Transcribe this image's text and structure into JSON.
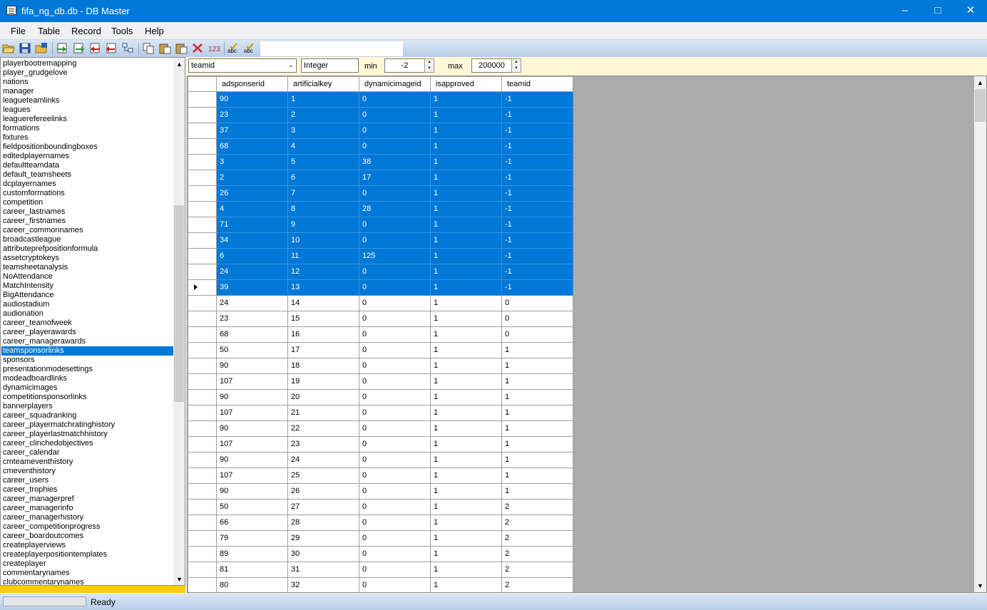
{
  "window": {
    "title": "fifa_ng_db.db - DB Master"
  },
  "menu": [
    "File",
    "Table",
    "Record",
    "Tools",
    "Help"
  ],
  "toolbar_icons": [
    "open-icon",
    "save-icon",
    "save-as-icon",
    "import-icon",
    "export-icon",
    "export-all-icon",
    "import-all-icon",
    "structure-icon",
    "copy-icon",
    "paste-icon",
    "paste-special-icon",
    "delete-icon",
    "numeric-icon",
    "spell-check-icon",
    "spell-check-all-icon"
  ],
  "sidebar": {
    "selected_index": 31,
    "items": [
      "playerbootremapping",
      "player_grudgelove",
      "nations",
      "manager",
      "leagueteamlinks",
      "leagues",
      "leaguerefereelinks",
      "formations",
      "fixtures",
      "fieldpositionboundingboxes",
      "editedplayernames",
      "defaultteamdata",
      "default_teamsheets",
      "dcplayernames",
      "customformations",
      "competition",
      "career_lastnames",
      "career_firstnames",
      "career_commonnames",
      "broadcastleague",
      "attributeprefpositionformula",
      "assetcryptokeys",
      "teamsheetanalysis",
      "NoAttendance",
      "MatchIntensity",
      "BigAttendance",
      "audiostadium",
      "audionation",
      "career_teamofweek",
      "career_playerawards",
      "career_managerawards",
      "teamsponsorlinks",
      "sponsors",
      "presentationmodesettings",
      "modeadboardlinks",
      "dynamicimages",
      "competitionsponsorlinks",
      "bannerplayers",
      "career_squadranking",
      "career_playermatchratinghistory",
      "career_playerlastmatchhistory",
      "career_clinchedobjectives",
      "career_calendar",
      "cmteameventhistory",
      "cmeventhistory",
      "career_users",
      "career_trophies",
      "career_managerpref",
      "career_managerinfo",
      "career_managerhistory",
      "career_competitionprogress",
      "career_boardoutcomes",
      "createplayerviews",
      "createplayerpositiontemplates",
      "createplayer",
      "commentarynames",
      "clubcommentarynames"
    ]
  },
  "filter": {
    "field": "teamid",
    "type": "Integer",
    "min_label": "min",
    "min_value": "-2",
    "max_label": "max",
    "max_value": "200000"
  },
  "grid": {
    "columns": [
      "adsponserid",
      "artificialkey",
      "dynamicimageid",
      "isapproved",
      "teamid"
    ],
    "selected_count": 13,
    "current_row": 12,
    "rows": [
      [
        "90",
        "1",
        "0",
        "1",
        "-1"
      ],
      [
        "23",
        "2",
        "0",
        "1",
        "-1"
      ],
      [
        "37",
        "3",
        "0",
        "1",
        "-1"
      ],
      [
        "68",
        "4",
        "0",
        "1",
        "-1"
      ],
      [
        "3",
        "5",
        "38",
        "1",
        "-1"
      ],
      [
        "2",
        "6",
        "17",
        "1",
        "-1"
      ],
      [
        "26",
        "7",
        "0",
        "1",
        "-1"
      ],
      [
        "4",
        "8",
        "28",
        "1",
        "-1"
      ],
      [
        "71",
        "9",
        "0",
        "1",
        "-1"
      ],
      [
        "34",
        "10",
        "0",
        "1",
        "-1"
      ],
      [
        "6",
        "11",
        "125",
        "1",
        "-1"
      ],
      [
        "24",
        "12",
        "0",
        "1",
        "-1"
      ],
      [
        "39",
        "13",
        "0",
        "1",
        "-1"
      ],
      [
        "24",
        "14",
        "0",
        "1",
        "0"
      ],
      [
        "23",
        "15",
        "0",
        "1",
        "0"
      ],
      [
        "68",
        "16",
        "0",
        "1",
        "0"
      ],
      [
        "50",
        "17",
        "0",
        "1",
        "1"
      ],
      [
        "90",
        "18",
        "0",
        "1",
        "1"
      ],
      [
        "107",
        "19",
        "0",
        "1",
        "1"
      ],
      [
        "90",
        "20",
        "0",
        "1",
        "1"
      ],
      [
        "107",
        "21",
        "0",
        "1",
        "1"
      ],
      [
        "90",
        "22",
        "0",
        "1",
        "1"
      ],
      [
        "107",
        "23",
        "0",
        "1",
        "1"
      ],
      [
        "90",
        "24",
        "0",
        "1",
        "1"
      ],
      [
        "107",
        "25",
        "0",
        "1",
        "1"
      ],
      [
        "90",
        "26",
        "0",
        "1",
        "1"
      ],
      [
        "50",
        "27",
        "0",
        "1",
        "2"
      ],
      [
        "66",
        "28",
        "0",
        "1",
        "2"
      ],
      [
        "79",
        "29",
        "0",
        "1",
        "2"
      ],
      [
        "89",
        "30",
        "0",
        "1",
        "2"
      ],
      [
        "81",
        "31",
        "0",
        "1",
        "2"
      ],
      [
        "80",
        "32",
        "0",
        "1",
        "2"
      ]
    ]
  },
  "status": {
    "text": "Ready"
  },
  "colors": {
    "titlebar": "#0078d7",
    "selection": "#0078d7",
    "filter_bg": "#fff7d6",
    "sidebar_footer": "#ffcc00"
  }
}
